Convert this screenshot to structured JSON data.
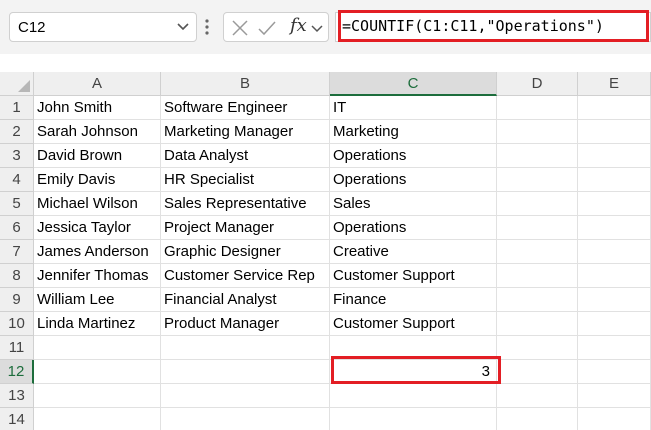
{
  "formula_bar": {
    "name_box": "C12",
    "fx_label": "fx",
    "formula": "=COUNTIF(C1:C11,\"Operations\")"
  },
  "columns": [
    "A",
    "B",
    "C",
    "D",
    "E"
  ],
  "rows": [
    {
      "num": "1",
      "a": "John Smith",
      "b": "Software Engineer",
      "c": "IT"
    },
    {
      "num": "2",
      "a": "Sarah Johnson",
      "b": "Marketing Manager",
      "c": "Marketing"
    },
    {
      "num": "3",
      "a": "David Brown",
      "b": "Data Analyst",
      "c": "Operations"
    },
    {
      "num": "4",
      "a": "Emily Davis",
      "b": "HR Specialist",
      "c": "Operations"
    },
    {
      "num": "5",
      "a": "Michael Wilson",
      "b": "Sales Representative",
      "c": "Sales"
    },
    {
      "num": "6",
      "a": "Jessica Taylor",
      "b": "Project Manager",
      "c": "Operations"
    },
    {
      "num": "7",
      "a": "James Anderson",
      "b": "Graphic Designer",
      "c": "Creative"
    },
    {
      "num": "8",
      "a": "Jennifer Thomas",
      "b": "Customer Service Rep",
      "c": "Customer Support"
    },
    {
      "num": "9",
      "a": "William Lee",
      "b": "Financial Analyst",
      "c": "Finance"
    },
    {
      "num": "10",
      "a": "Linda Martinez",
      "b": "Product Manager",
      "c": "Customer Support"
    },
    {
      "num": "11",
      "a": "",
      "b": "",
      "c": ""
    },
    {
      "num": "12",
      "a": "",
      "b": "",
      "c": "3"
    },
    {
      "num": "13",
      "a": "",
      "b": "",
      "c": ""
    },
    {
      "num": "14",
      "a": "",
      "b": "",
      "c": ""
    }
  ],
  "selected_cell": "C12",
  "highlight_color": "#e31e24"
}
